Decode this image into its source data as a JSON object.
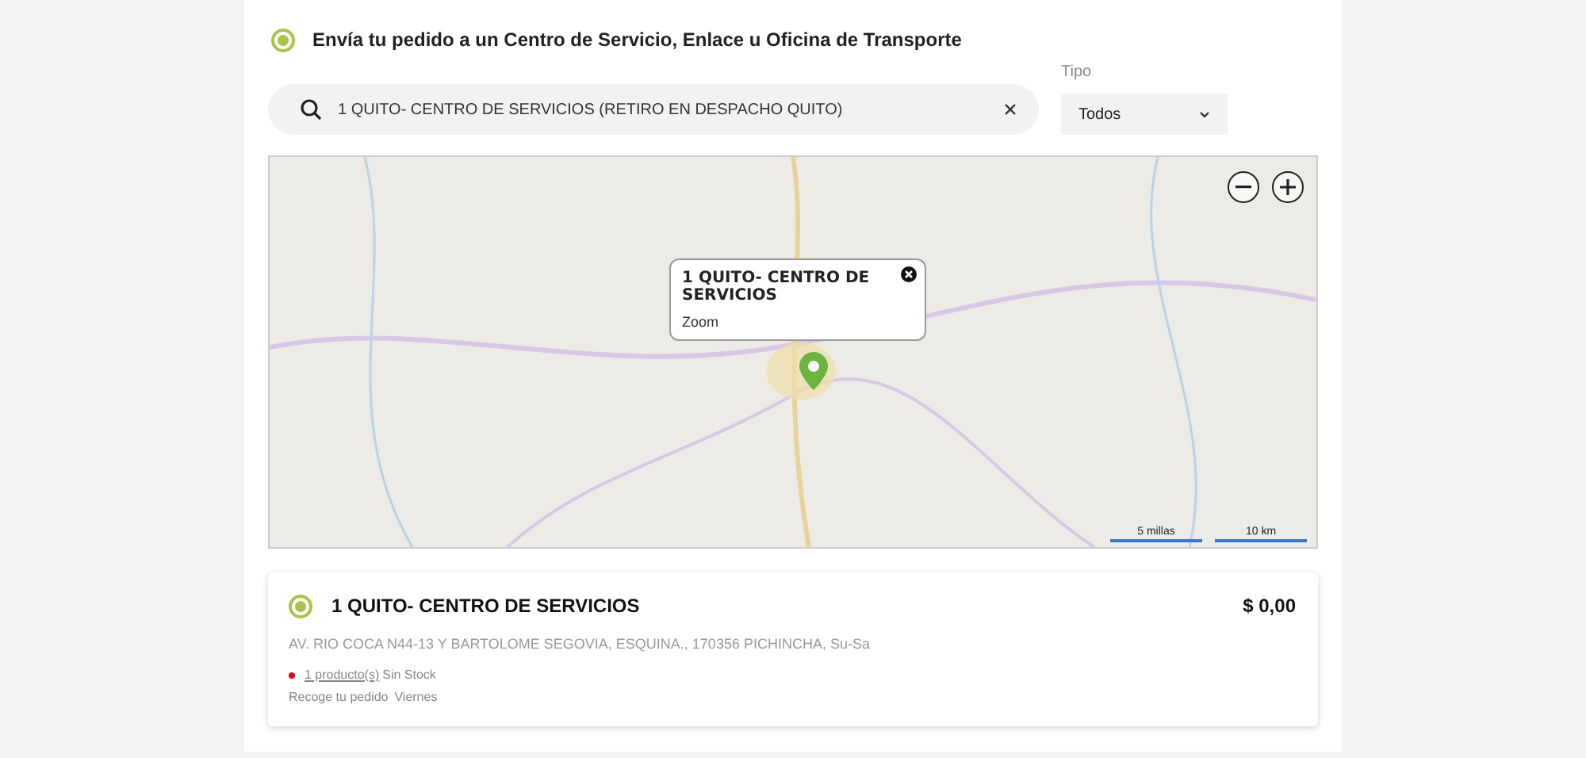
{
  "delivery_option": {
    "label": "Envía tu pedido a un Centro de Servicio, Enlace u Oficina de Transporte",
    "selected": true
  },
  "search": {
    "value": "1 QUITO- CENTRO DE SERVICIOS (RETIRO EN DESPACHO QUITO)"
  },
  "type_filter": {
    "label": "Tipo",
    "value": "Todos"
  },
  "map": {
    "popup": {
      "title": "1 QUITO- CENTRO DE SERVICIOS",
      "link": "Zoom"
    },
    "scale": [
      "5 millas",
      "10 km"
    ]
  },
  "results": [
    {
      "name": "1 QUITO- CENTRO DE SERVICIOS",
      "selected": true,
      "price": "$ 0,00",
      "address": "AV. RIO COCA N44-13 Y BARTOLOME SEGOVIA, ESQUINA., 170356 PICHINCHA, Su-Sa",
      "stock_link": "1 producto(s)",
      "stock_status": "Sin Stock",
      "color": "#e30613",
      "pickup_label": "Recoge tu pedido",
      "pickup_day": "Viernes"
    }
  ]
}
